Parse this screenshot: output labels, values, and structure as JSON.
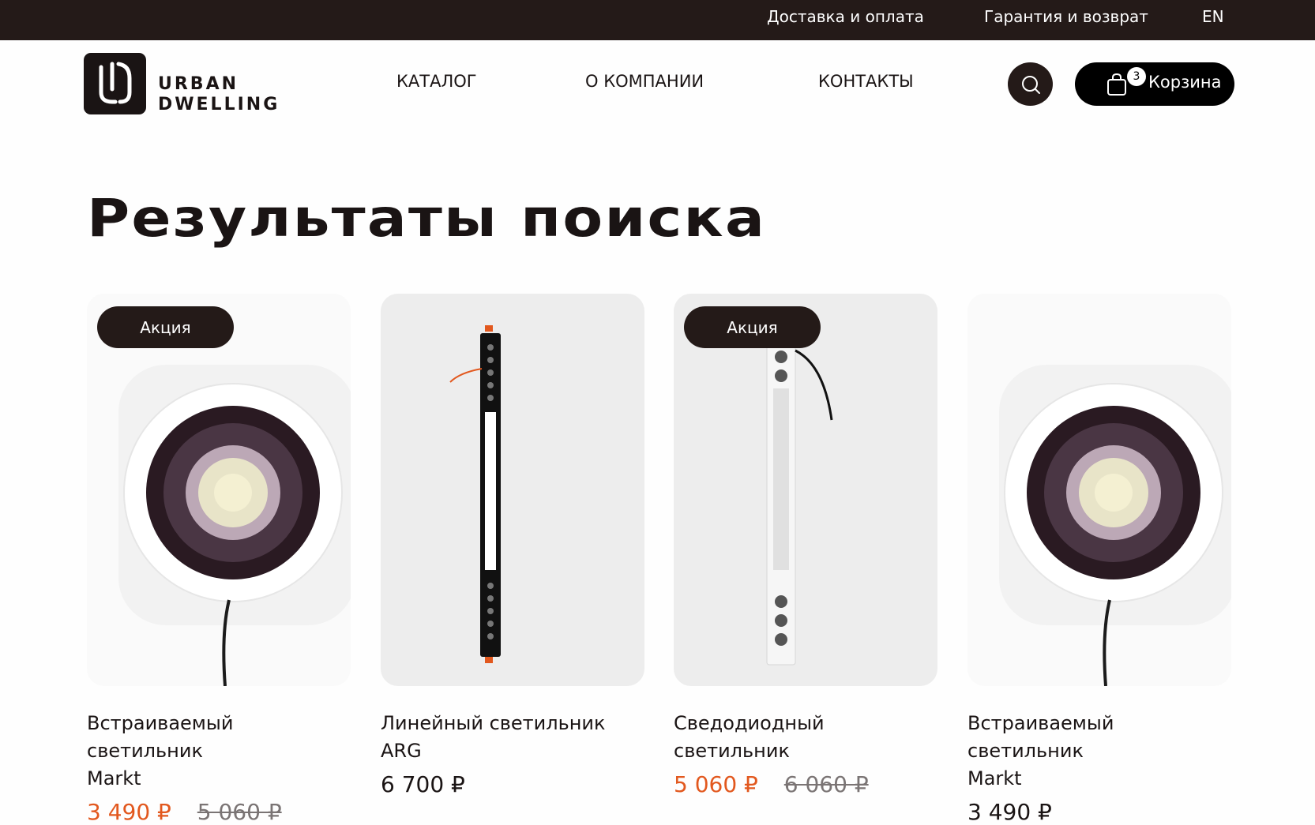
{
  "topbar": {
    "delivery": "Доставка и оплата",
    "warranty": "Гарантия и возврат",
    "lang": "EN"
  },
  "header": {
    "logo_line1": "URBAN",
    "logo_line2": "DWELLING",
    "nav": [
      "КАТАЛОГ",
      "О КОМПАНИИ",
      "КОНТАКТЫ"
    ],
    "cart_label": "Корзина",
    "cart_count": "3"
  },
  "page": {
    "title": "Результаты поиска"
  },
  "products": [
    {
      "badge": "Акция",
      "name_line1": "Встраиваемый светильник",
      "name_line2": "Markt",
      "price": "3 490 ₽",
      "old_price": "5 060 ₽",
      "on_sale": true
    },
    {
      "badge": "",
      "name_line1": "Линейный светильник ARG",
      "name_line2": "",
      "price": "6 700 ₽",
      "old_price": "",
      "on_sale": false
    },
    {
      "badge": "Акция",
      "name_line1": "Сведодиодный светильник",
      "name_line2": "",
      "price": "5 060 ₽",
      "old_price": "6 060 ₽",
      "on_sale": true
    },
    {
      "badge": "",
      "name_line1": "Встраиваемый светильник",
      "name_line2": "Markt",
      "price": "3 490 ₽",
      "old_price": "",
      "on_sale": false
    }
  ],
  "colors": {
    "dark": "#241a18",
    "sale": "#e2581e",
    "old_price": "#7a7474"
  },
  "icons": {
    "search": "search-icon",
    "cart": "shopping-bag-icon",
    "logo": "logo-icon"
  }
}
